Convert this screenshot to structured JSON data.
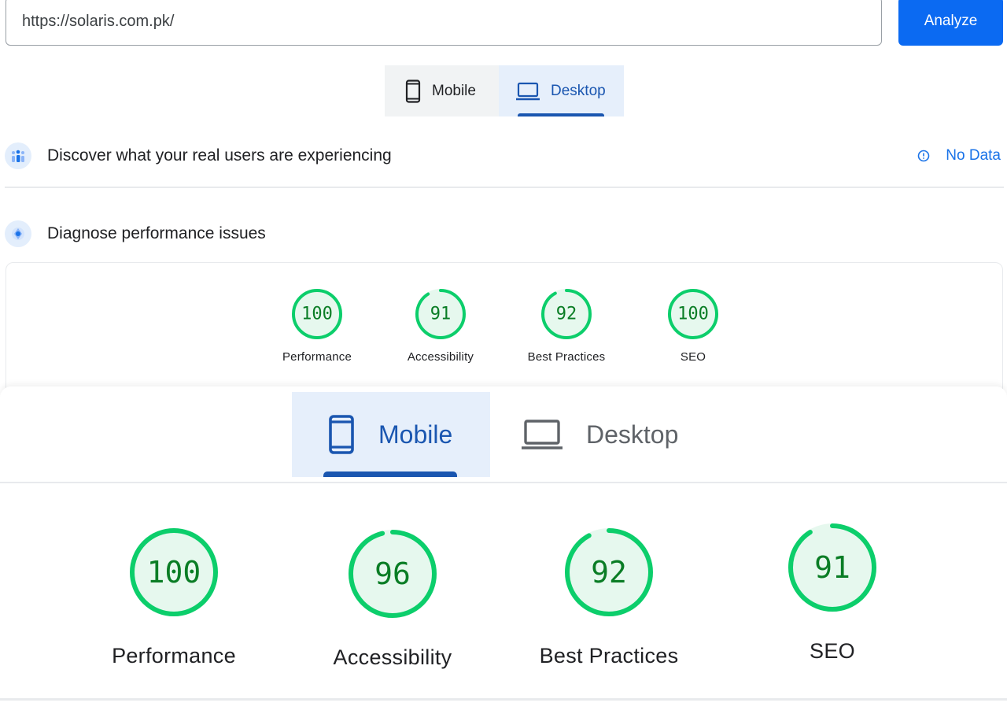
{
  "url_bar": {
    "value": "https://solaris.com.pk/"
  },
  "analyze_button": {
    "label": "Analyze"
  },
  "device_tabs_top": {
    "mobile_label": "Mobile",
    "desktop_label": "Desktop",
    "selected": "Desktop"
  },
  "discover": {
    "title": "Discover what your real users are experiencing",
    "status": "No Data"
  },
  "diagnose": {
    "title": "Diagnose performance issues"
  },
  "scores_top": [
    {
      "label": "Performance",
      "score": 100
    },
    {
      "label": "Accessibility",
      "score": 91
    },
    {
      "label": "Best Practices",
      "score": 92
    },
    {
      "label": "SEO",
      "score": 100
    }
  ],
  "device_tabs_bottom": {
    "mobile_label": "Mobile",
    "desktop_label": "Desktop",
    "selected": "Mobile"
  },
  "scores_bottom": [
    {
      "label": "Performance",
      "score": 100
    },
    {
      "label": "Accessibility",
      "score": 96
    },
    {
      "label": "Best Practices",
      "score": 92
    },
    {
      "label": "SEO",
      "score": 91
    }
  ],
  "colors": {
    "accent": "#0b6af2",
    "tab_selected": "#1a56b0",
    "score_good": "#0cce6b",
    "score_text": "#0a7d25"
  }
}
